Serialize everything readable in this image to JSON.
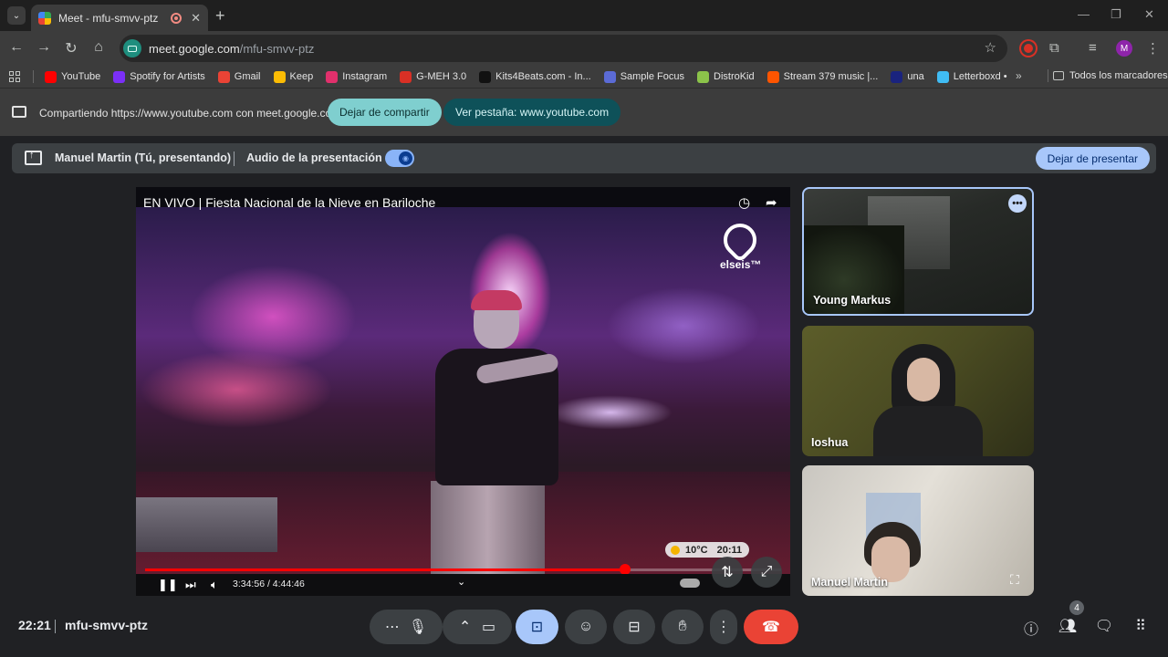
{
  "browser": {
    "tab_title": "Meet - mfu-smvv-ptz",
    "url_host": "meet.google.com",
    "url_path": "/mfu-smvv-ptz",
    "profile_initial": "M"
  },
  "bookmarks": [
    {
      "label": "YouTube",
      "color": "#ff0000"
    },
    {
      "label": "Spotify for Artists",
      "color": "#7b2ff7"
    },
    {
      "label": "Gmail",
      "color": "#ea4335"
    },
    {
      "label": "Keep",
      "color": "#fbbc04"
    },
    {
      "label": "Instagram",
      "color": "#e1306c"
    },
    {
      "label": "G-MEH 3.0",
      "color": "#d93025"
    },
    {
      "label": "Kits4Beats.com - In...",
      "color": "#111111"
    },
    {
      "label": "Sample Focus",
      "color": "#5b6bd6"
    },
    {
      "label": "DistroKid",
      "color": "#8bc34a"
    },
    {
      "label": "Stream 379 music |...",
      "color": "#ff5500"
    },
    {
      "label": "una",
      "color": "#1a237e"
    },
    {
      "label": "Letterboxd •",
      "color": "#40bcf4"
    }
  ],
  "all_bookmarks_label": "Todos los marcadores",
  "sharebar": {
    "text": "Compartiendo https://www.youtube.com con meet.google.com",
    "stop_label": "Dejar de compartir",
    "view_label": "Ver pestaña: www.youtube.com"
  },
  "present_bar": {
    "presenter": "Manuel Martin (Tú, presentando)",
    "audio_label": "Audio de la presentación",
    "audio_enabled": true,
    "stop_label": "Dejar de presentar"
  },
  "video": {
    "title": "EN VIVO | Fiesta Nacional de la Nieve en Bariloche",
    "channel_logo": "elseis™",
    "temperature": "10°C",
    "clock": "20:11",
    "time": "3:34:56 / 4:44:46",
    "progress": 0.755
  },
  "participants": [
    {
      "name": "Young Markus"
    },
    {
      "name": "Ioshua"
    },
    {
      "name": "Manuel Martin"
    }
  ],
  "meeting": {
    "time": "22:21",
    "code": "mfu-smvv-ptz",
    "participant_count": "4"
  },
  "colors": {
    "accent": "#a8c7fa",
    "end_call": "#ea4335",
    "share_pill": "#7fcfcf"
  }
}
